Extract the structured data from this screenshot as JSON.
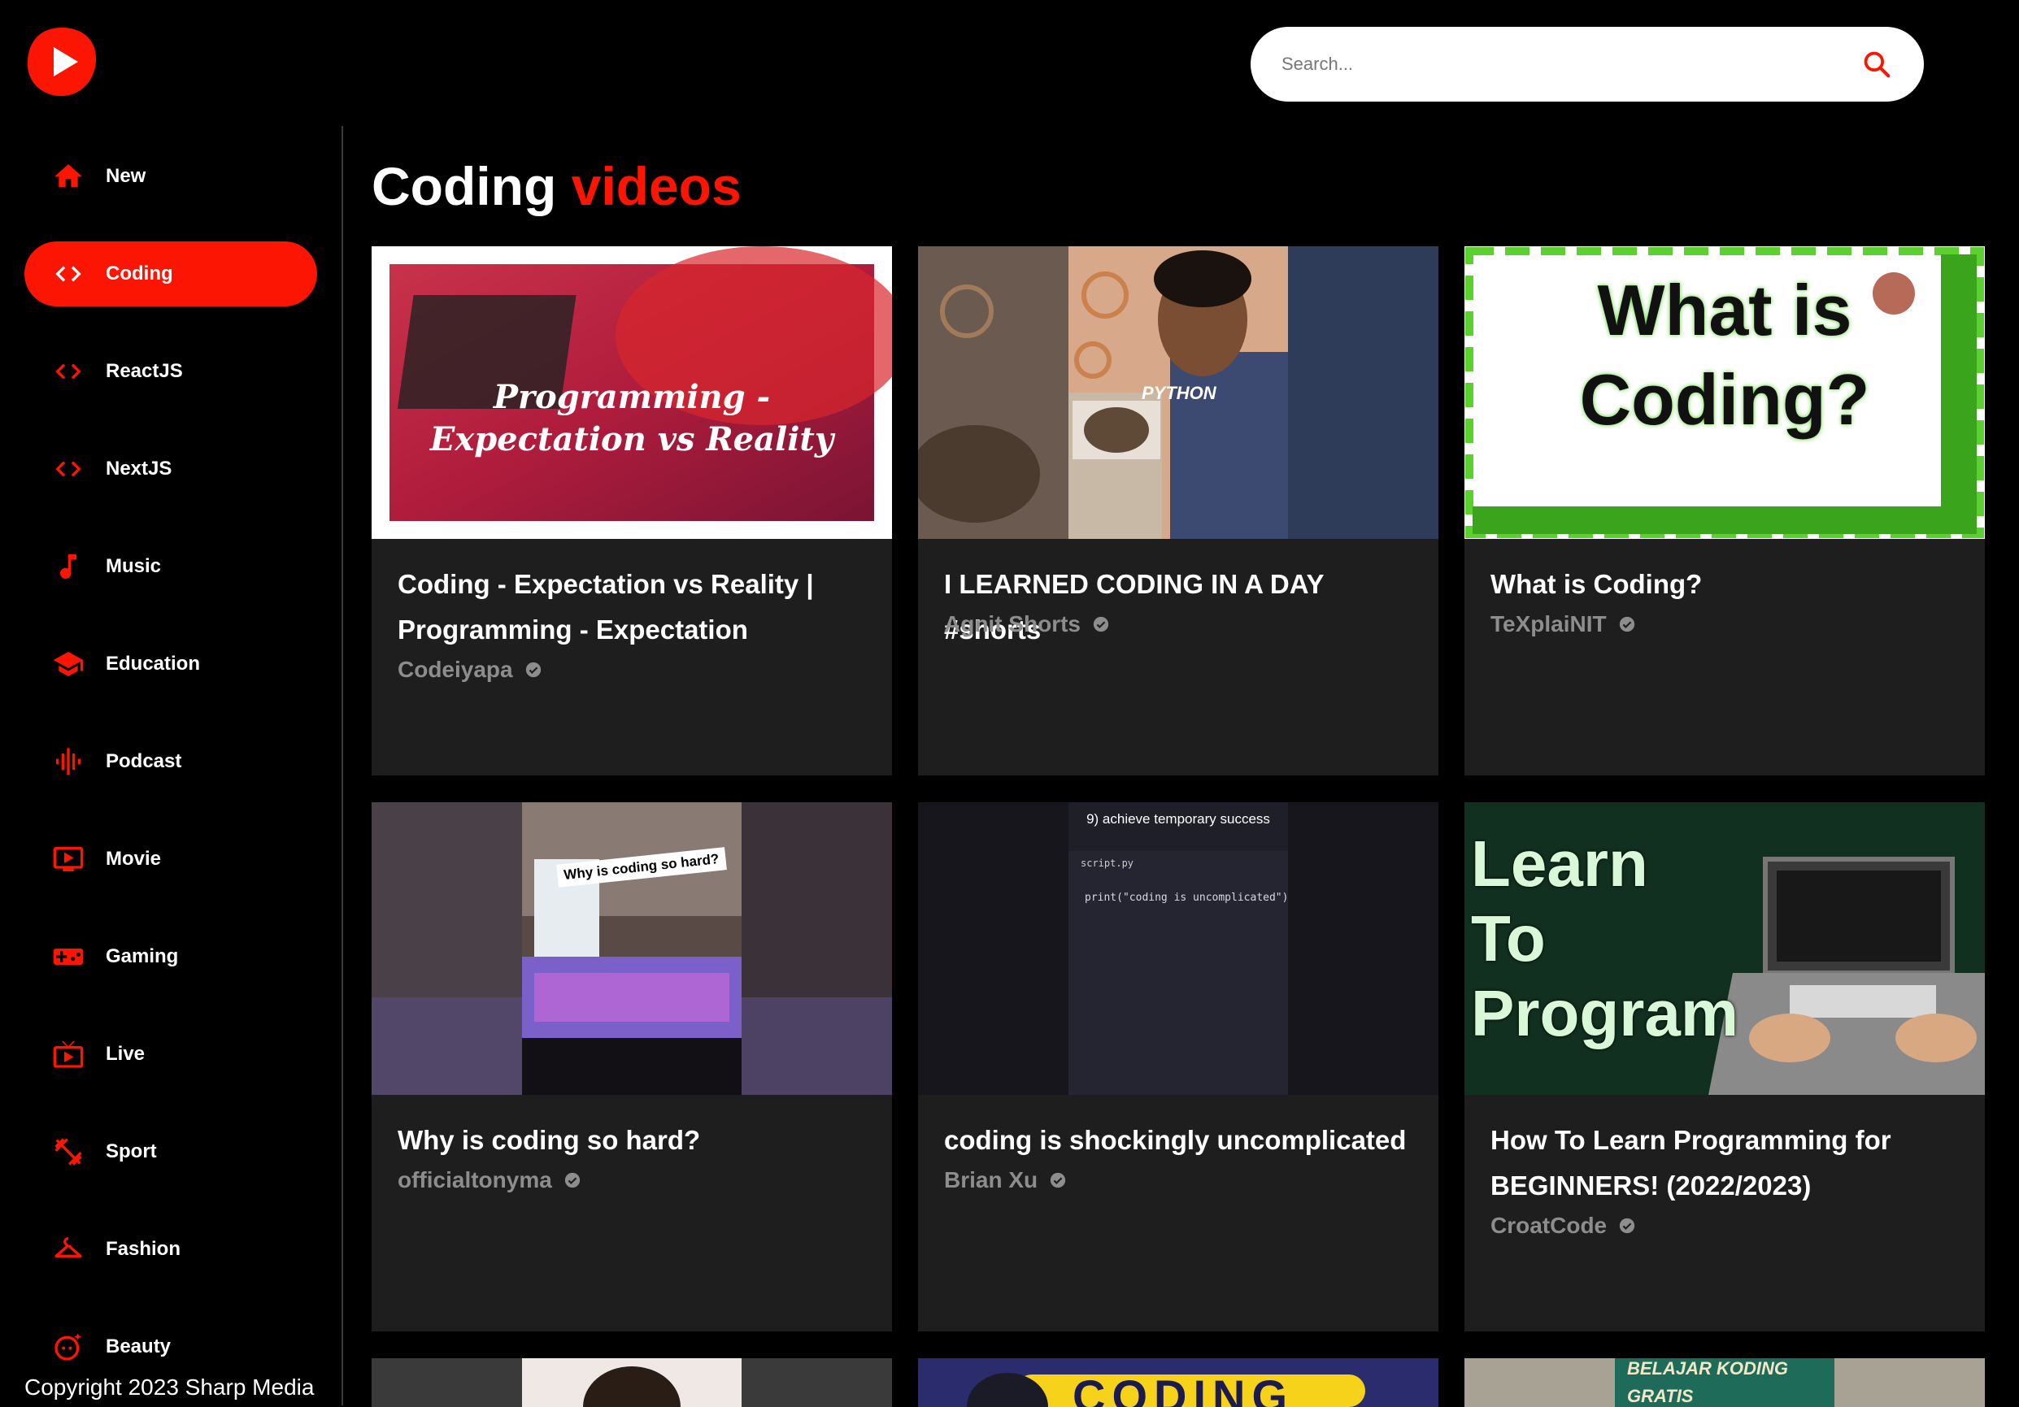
{
  "app": {
    "logo_icon": "youtube-play-logo-icon",
    "brand_color": "#fc1503"
  },
  "search": {
    "placeholder": "Search...",
    "icon": "search-icon"
  },
  "sidebar": {
    "items": [
      {
        "label": "New",
        "icon": "home-icon",
        "active": false
      },
      {
        "label": "Coding",
        "icon": "code-icon",
        "active": true
      },
      {
        "label": "ReactJS",
        "icon": "code-icon",
        "active": false
      },
      {
        "label": "NextJS",
        "icon": "code-icon",
        "active": false
      },
      {
        "label": "Music",
        "icon": "music-note-icon",
        "active": false
      },
      {
        "label": "Education",
        "icon": "school-icon",
        "active": false
      },
      {
        "label": "Podcast",
        "icon": "graphic-eq-icon",
        "active": false
      },
      {
        "label": "Movie",
        "icon": "ondemand-video-icon",
        "active": false
      },
      {
        "label": "Gaming",
        "icon": "gamepad-icon",
        "active": false
      },
      {
        "label": "Live",
        "icon": "live-tv-icon",
        "active": false
      },
      {
        "label": "Sport",
        "icon": "fitness-icon",
        "active": false
      },
      {
        "label": "Fashion",
        "icon": "hanger-icon",
        "active": false
      },
      {
        "label": "Beauty",
        "icon": "face-retouching-icon",
        "active": false
      }
    ]
  },
  "footer": {
    "copyright": "Copyright 2023 Sharp Media"
  },
  "main": {
    "title_primary": "Coding",
    "title_accent": "videos",
    "videos": [
      {
        "title": "Coding - Expectation vs Reality | Programming - Expectation",
        "channel": "Codeiyapa",
        "verified": true,
        "thumbnail_text": "Programming - Expectation vs Reality"
      },
      {
        "title": "I LEARNED CODING IN A DAY #shorts",
        "channel": "Agnit Shorts",
        "verified": true,
        "thumbnail_text": "PYTHON"
      },
      {
        "title": "What is Coding?",
        "channel": "TeXplaiNIT",
        "verified": true,
        "thumbnail_text": "What is Coding?"
      },
      {
        "title": "Why is coding so hard?",
        "channel": "officialtonyma",
        "verified": true,
        "thumbnail_text": "Why is coding so hard?"
      },
      {
        "title": "coding is shockingly uncomplicated",
        "channel": "Brian Xu",
        "verified": true,
        "thumbnail_text": "9) achieve temporary success",
        "thumbnail_code": "print(\"coding is uncomplicated\")",
        "thumbnail_file": "script.py"
      },
      {
        "title": "How To Learn Programming for BEGINNERS! (2022/2023)",
        "channel": "CroatCode",
        "verified": true,
        "thumbnail_text": "Learn To Program"
      }
    ],
    "partial_row": [
      {
        "thumbnail_text": "CODING"
      },
      {
        "thumbnail_text": "BELAJAR KODING GRATIS"
      }
    ]
  }
}
